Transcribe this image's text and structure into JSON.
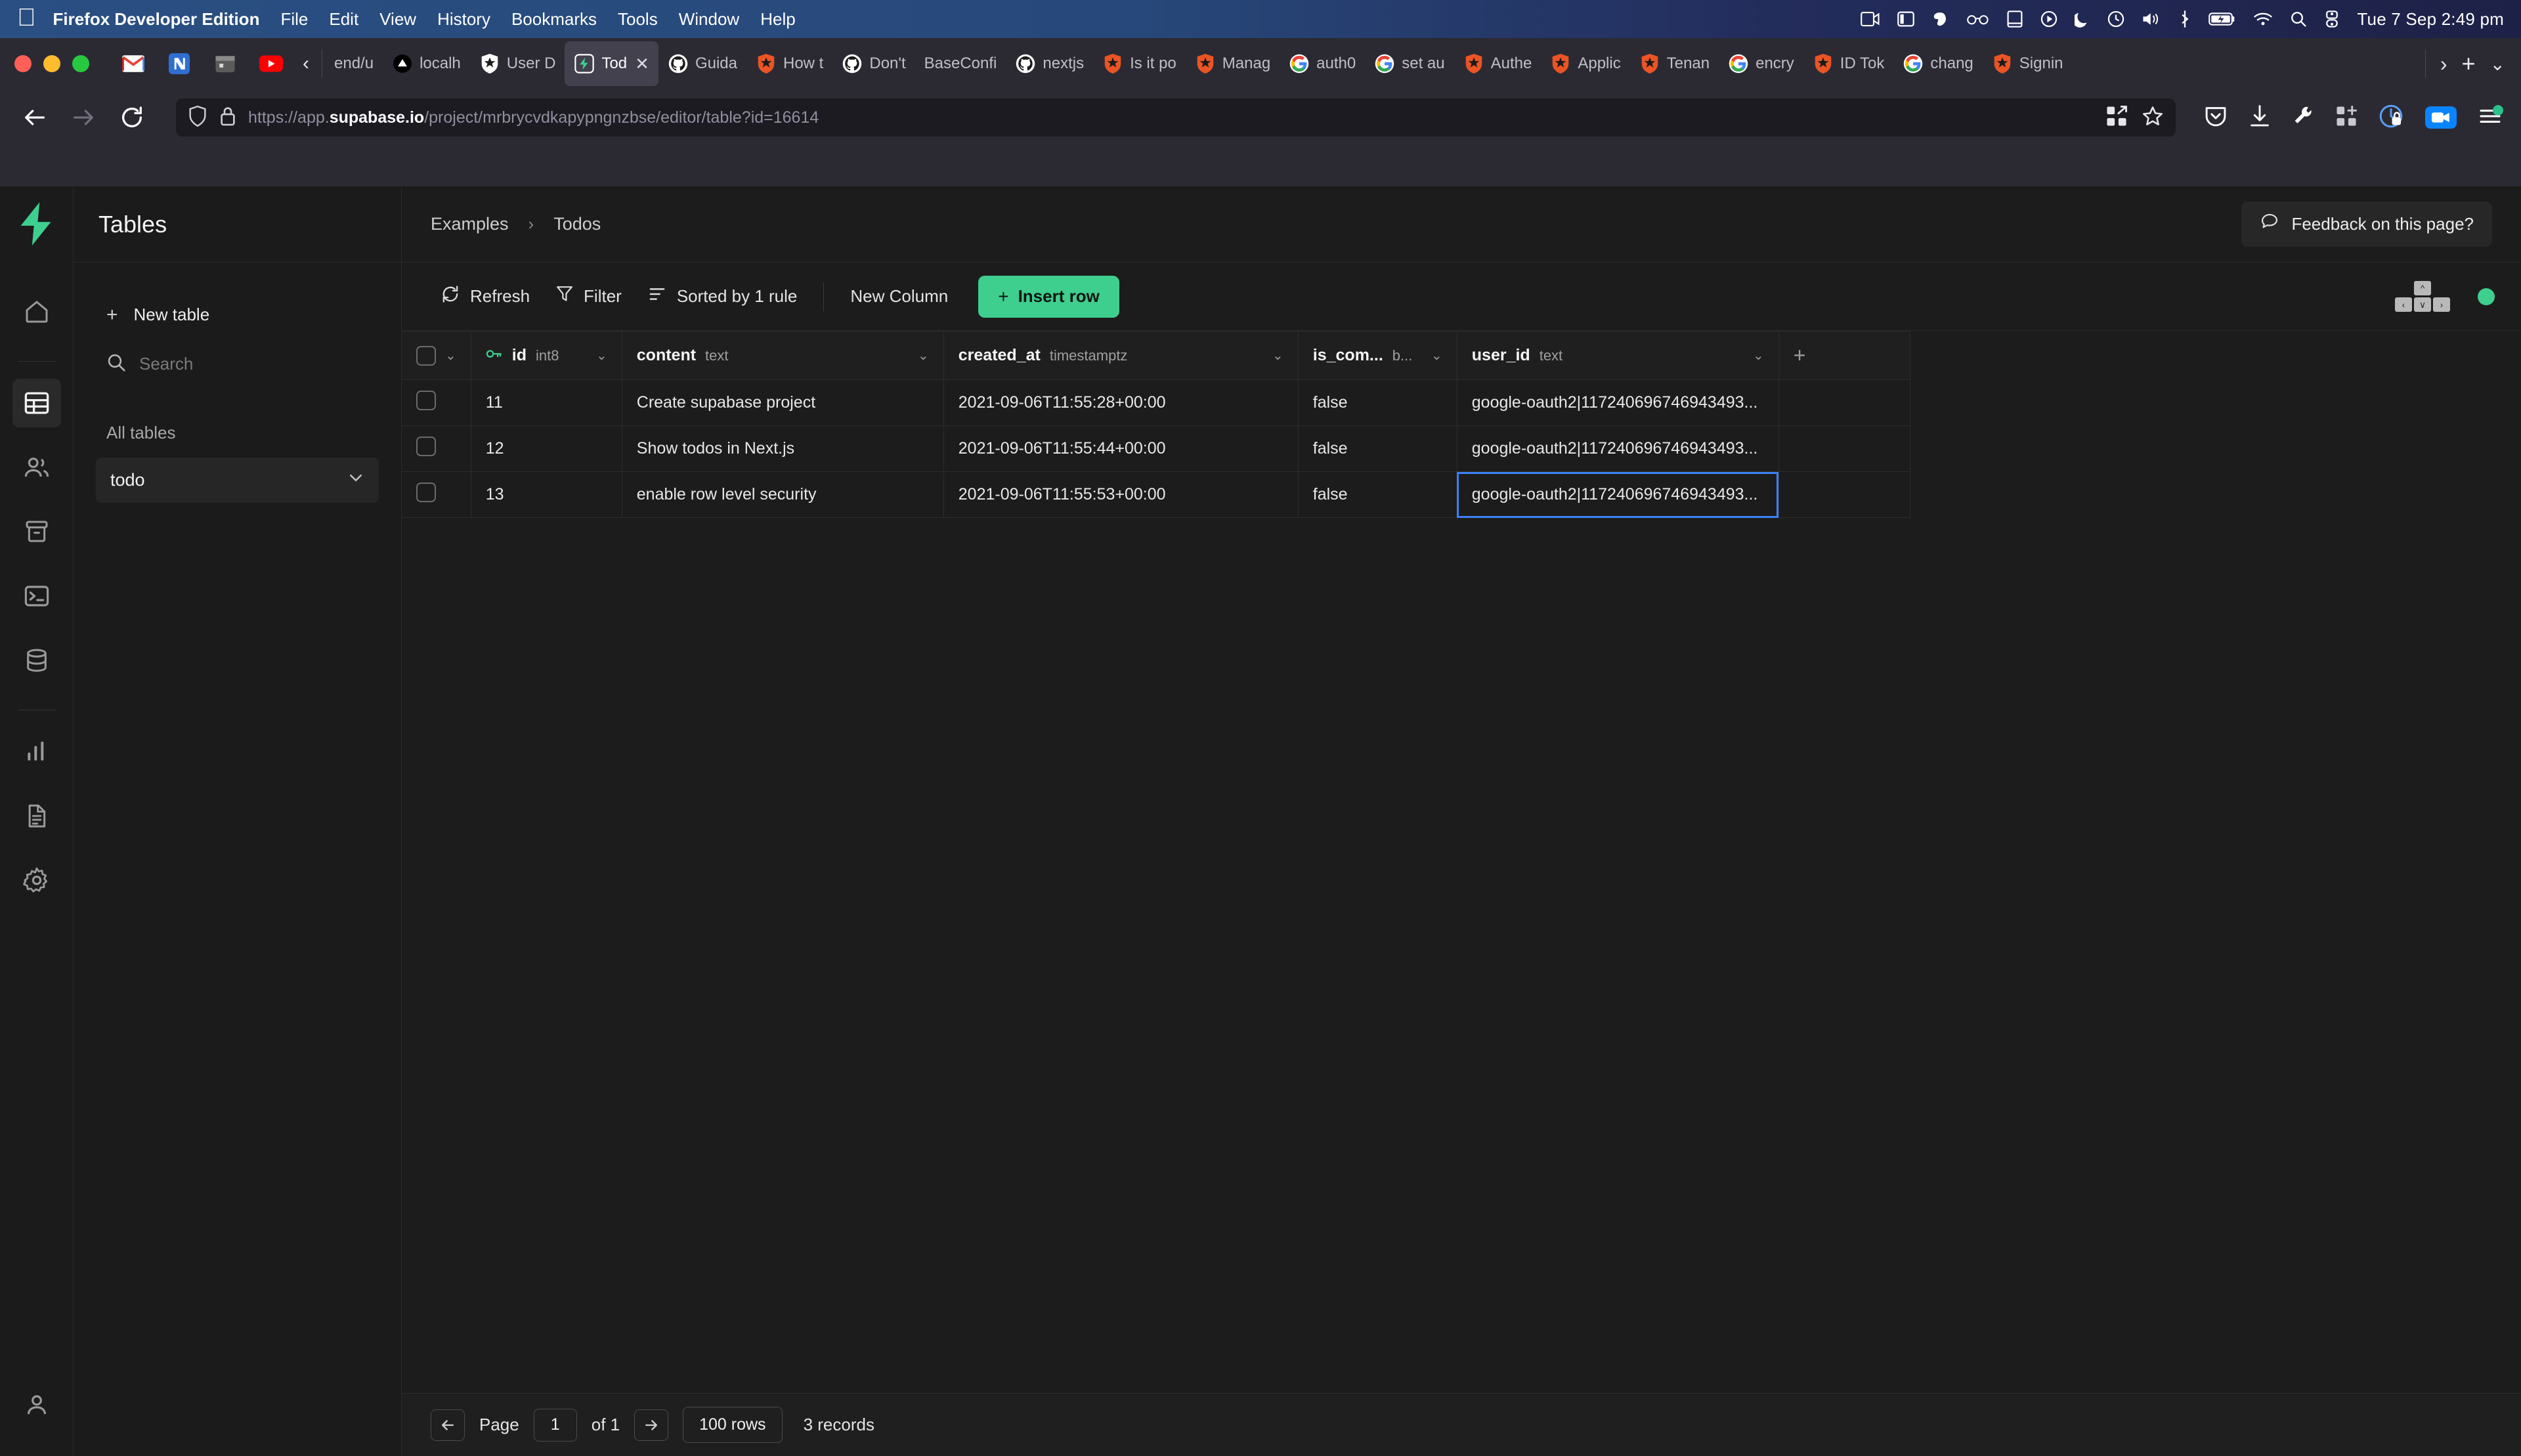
{
  "os_menubar": {
    "apple_icon": "apple-logo",
    "items": [
      {
        "label": "Firefox Developer Edition",
        "bold": true
      },
      {
        "label": "File",
        "bold": false
      },
      {
        "label": "Edit",
        "bold": false
      },
      {
        "label": "View",
        "bold": false
      },
      {
        "label": "History",
        "bold": false
      },
      {
        "label": "Bookmarks",
        "bold": false
      },
      {
        "label": "Tools",
        "bold": false
      },
      {
        "label": "Window",
        "bold": false
      },
      {
        "label": "Help",
        "bold": false
      }
    ],
    "status_icons": [
      "screen-recording-icon",
      "sidebar-icon",
      "evernote-icon",
      "glasses-icon",
      "notebook-icon",
      "play-circle-icon",
      "moon-icon",
      "time-machine-icon",
      "volume-icon",
      "bluetooth-icon",
      "battery-charging-icon",
      "wifi-icon",
      "search-icon",
      "control-center-icon"
    ],
    "clock": "Tue 7 Sep  2:49 pm"
  },
  "browser": {
    "window_controls": [
      "close",
      "minimize",
      "zoom"
    ],
    "pinned_tabs": [
      "gmail-icon",
      "notion-icon",
      "calendar-icon",
      "youtube-icon"
    ],
    "scroll_left_icon": "chevron-left-icon",
    "tabs": [
      {
        "label": "end/u",
        "favicon": "none",
        "active": false
      },
      {
        "label": "localh",
        "favicon": "vercel-icon",
        "active": false
      },
      {
        "label": "User D",
        "favicon": "auth0-white-icon",
        "active": false
      },
      {
        "label": "Tod",
        "favicon": "supabase-icon",
        "active": true,
        "closable": true
      },
      {
        "label": "Guida",
        "favicon": "github-icon",
        "active": false
      },
      {
        "label": "How t",
        "favicon": "auth0-icon",
        "active": false
      },
      {
        "label": "Don't",
        "favicon": "github-icon",
        "active": false
      },
      {
        "label": "BaseConfi",
        "favicon": "none",
        "active": false
      },
      {
        "label": "nextjs",
        "favicon": "github-icon",
        "active": false
      },
      {
        "label": "Is it po",
        "favicon": "auth0-icon",
        "active": false
      },
      {
        "label": "Manag",
        "favicon": "auth0-icon",
        "active": false
      },
      {
        "label": "auth0",
        "favicon": "google-icon",
        "active": false
      },
      {
        "label": "set au",
        "favicon": "google-icon",
        "active": false
      },
      {
        "label": "Authe",
        "favicon": "auth0-icon",
        "active": false
      },
      {
        "label": "Applic",
        "favicon": "auth0-icon",
        "active": false
      },
      {
        "label": "Tenan",
        "favicon": "auth0-icon",
        "active": false
      },
      {
        "label": "encry",
        "favicon": "google-icon",
        "active": false
      },
      {
        "label": "ID Tok",
        "favicon": "auth0-icon",
        "active": false
      },
      {
        "label": "chang",
        "favicon": "google-icon",
        "active": false
      },
      {
        "label": "Signin",
        "favicon": "auth0-icon",
        "active": false
      }
    ],
    "tabstrip_buttons": [
      "chevron-right-icon",
      "new-tab-icon",
      "list-all-tabs-icon"
    ],
    "nav": {
      "back_icon": "arrow-left-icon",
      "forward_icon": "arrow-right-icon",
      "reload_icon": "reload-icon"
    },
    "urlbar": {
      "shield_icon": "shield-icon",
      "lock_icon": "padlock-icon",
      "url_prefix": "https://app.",
      "url_host": "supabase.io",
      "url_path": "/project/mrbrycvdkapypngnzbse/editor/table?id=16614",
      "full_url": "https://app.supabase.io/project/mrbrycvdkapypngnzbse/editor/table?id=16614",
      "extensions_icon": "extensions-grid-icon",
      "bookmark_icon": "star-icon"
    },
    "toolbar_icons": [
      "pocket-icon",
      "downloads-icon",
      "devtools-wrench-icon",
      "addons-icon",
      "private-browsing-icon",
      "video-call-icon",
      "app-menu-icon"
    ]
  },
  "app": {
    "rail": {
      "logo": "supabase-lightning-logo",
      "items": [
        {
          "name": "home",
          "icon": "home-icon",
          "active": false
        },
        {
          "name": "table-editor",
          "icon": "table-icon",
          "active": true
        },
        {
          "name": "authentication",
          "icon": "users-icon",
          "active": false
        },
        {
          "name": "storage",
          "icon": "archive-icon",
          "active": false
        },
        {
          "name": "sql-editor",
          "icon": "terminal-icon",
          "active": false
        },
        {
          "name": "database",
          "icon": "database-icon",
          "active": false
        },
        {
          "name": "reports",
          "icon": "bar-chart-icon",
          "active": false
        },
        {
          "name": "logs",
          "icon": "document-icon",
          "active": false
        },
        {
          "name": "settings",
          "icon": "gear-icon",
          "active": false
        }
      ],
      "account_icon": "user-icon"
    },
    "sidebar": {
      "title": "Tables",
      "new_table_label": "New table",
      "new_table_icon": "plus-icon",
      "search": {
        "placeholder": "Search",
        "value": "",
        "icon": "search-icon"
      },
      "all_tables_label": "All tables",
      "tables": [
        {
          "name": "todo",
          "caret": "chevron-down-icon",
          "selected": true
        }
      ]
    },
    "header": {
      "breadcrumb": [
        "Examples",
        "Todos"
      ],
      "breadcrumb_separator": "›",
      "feedback_label": "Feedback on this page?",
      "feedback_icon": "comment-icon"
    },
    "toolbar": {
      "refresh_label": "Refresh",
      "refresh_icon": "refresh-icon",
      "filter_label": "Filter",
      "filter_icon": "funnel-icon",
      "sort_label": "Sorted by 1 rule",
      "sort_icon": "sort-list-icon",
      "new_column_label": "New Column",
      "insert_row_label": "Insert row",
      "insert_row_icon": "plus-icon",
      "keycaps": [
        "^",
        "‹",
        "∨",
        "›"
      ],
      "status_indicator_color": "#3ecf8e"
    },
    "grid": {
      "columns": [
        {
          "name": "",
          "type": "",
          "kind": "checkbox",
          "caret": true
        },
        {
          "name": "id",
          "type": "int8",
          "kind": "key",
          "caret": true
        },
        {
          "name": "content",
          "type": "text",
          "kind": "normal",
          "caret": true
        },
        {
          "name": "created_at",
          "type": "timestamptz",
          "kind": "normal",
          "caret": true
        },
        {
          "name": "is_com...",
          "type": "b...",
          "kind": "normal",
          "caret": true
        },
        {
          "name": "user_id",
          "type": "text",
          "kind": "normal",
          "caret": true
        },
        {
          "name": "",
          "type": "",
          "kind": "add",
          "caret": false
        }
      ],
      "rows": [
        {
          "id": "11",
          "content": "Create supabase project",
          "created_at": "2021-09-06T11:55:28+00:00",
          "is_completed": "false",
          "user_id": "google-oauth2|117240696746943493...",
          "selected_cell": null
        },
        {
          "id": "12",
          "content": "Show todos in Next.js",
          "created_at": "2021-09-06T11:55:44+00:00",
          "is_completed": "false",
          "user_id": "google-oauth2|117240696746943493...",
          "selected_cell": null
        },
        {
          "id": "13",
          "content": "enable row level security",
          "created_at": "2021-09-06T11:55:53+00:00",
          "is_completed": "false",
          "user_id": "google-oauth2|117240696746943493...",
          "selected_cell": "user_id"
        }
      ]
    },
    "footer": {
      "prev_icon": "arrow-left-icon",
      "next_icon": "arrow-right-icon",
      "page_label": "Page",
      "page_value": "1",
      "of_label": "of 1",
      "rows_per_page": "100 rows",
      "records_label": "3 records"
    }
  }
}
